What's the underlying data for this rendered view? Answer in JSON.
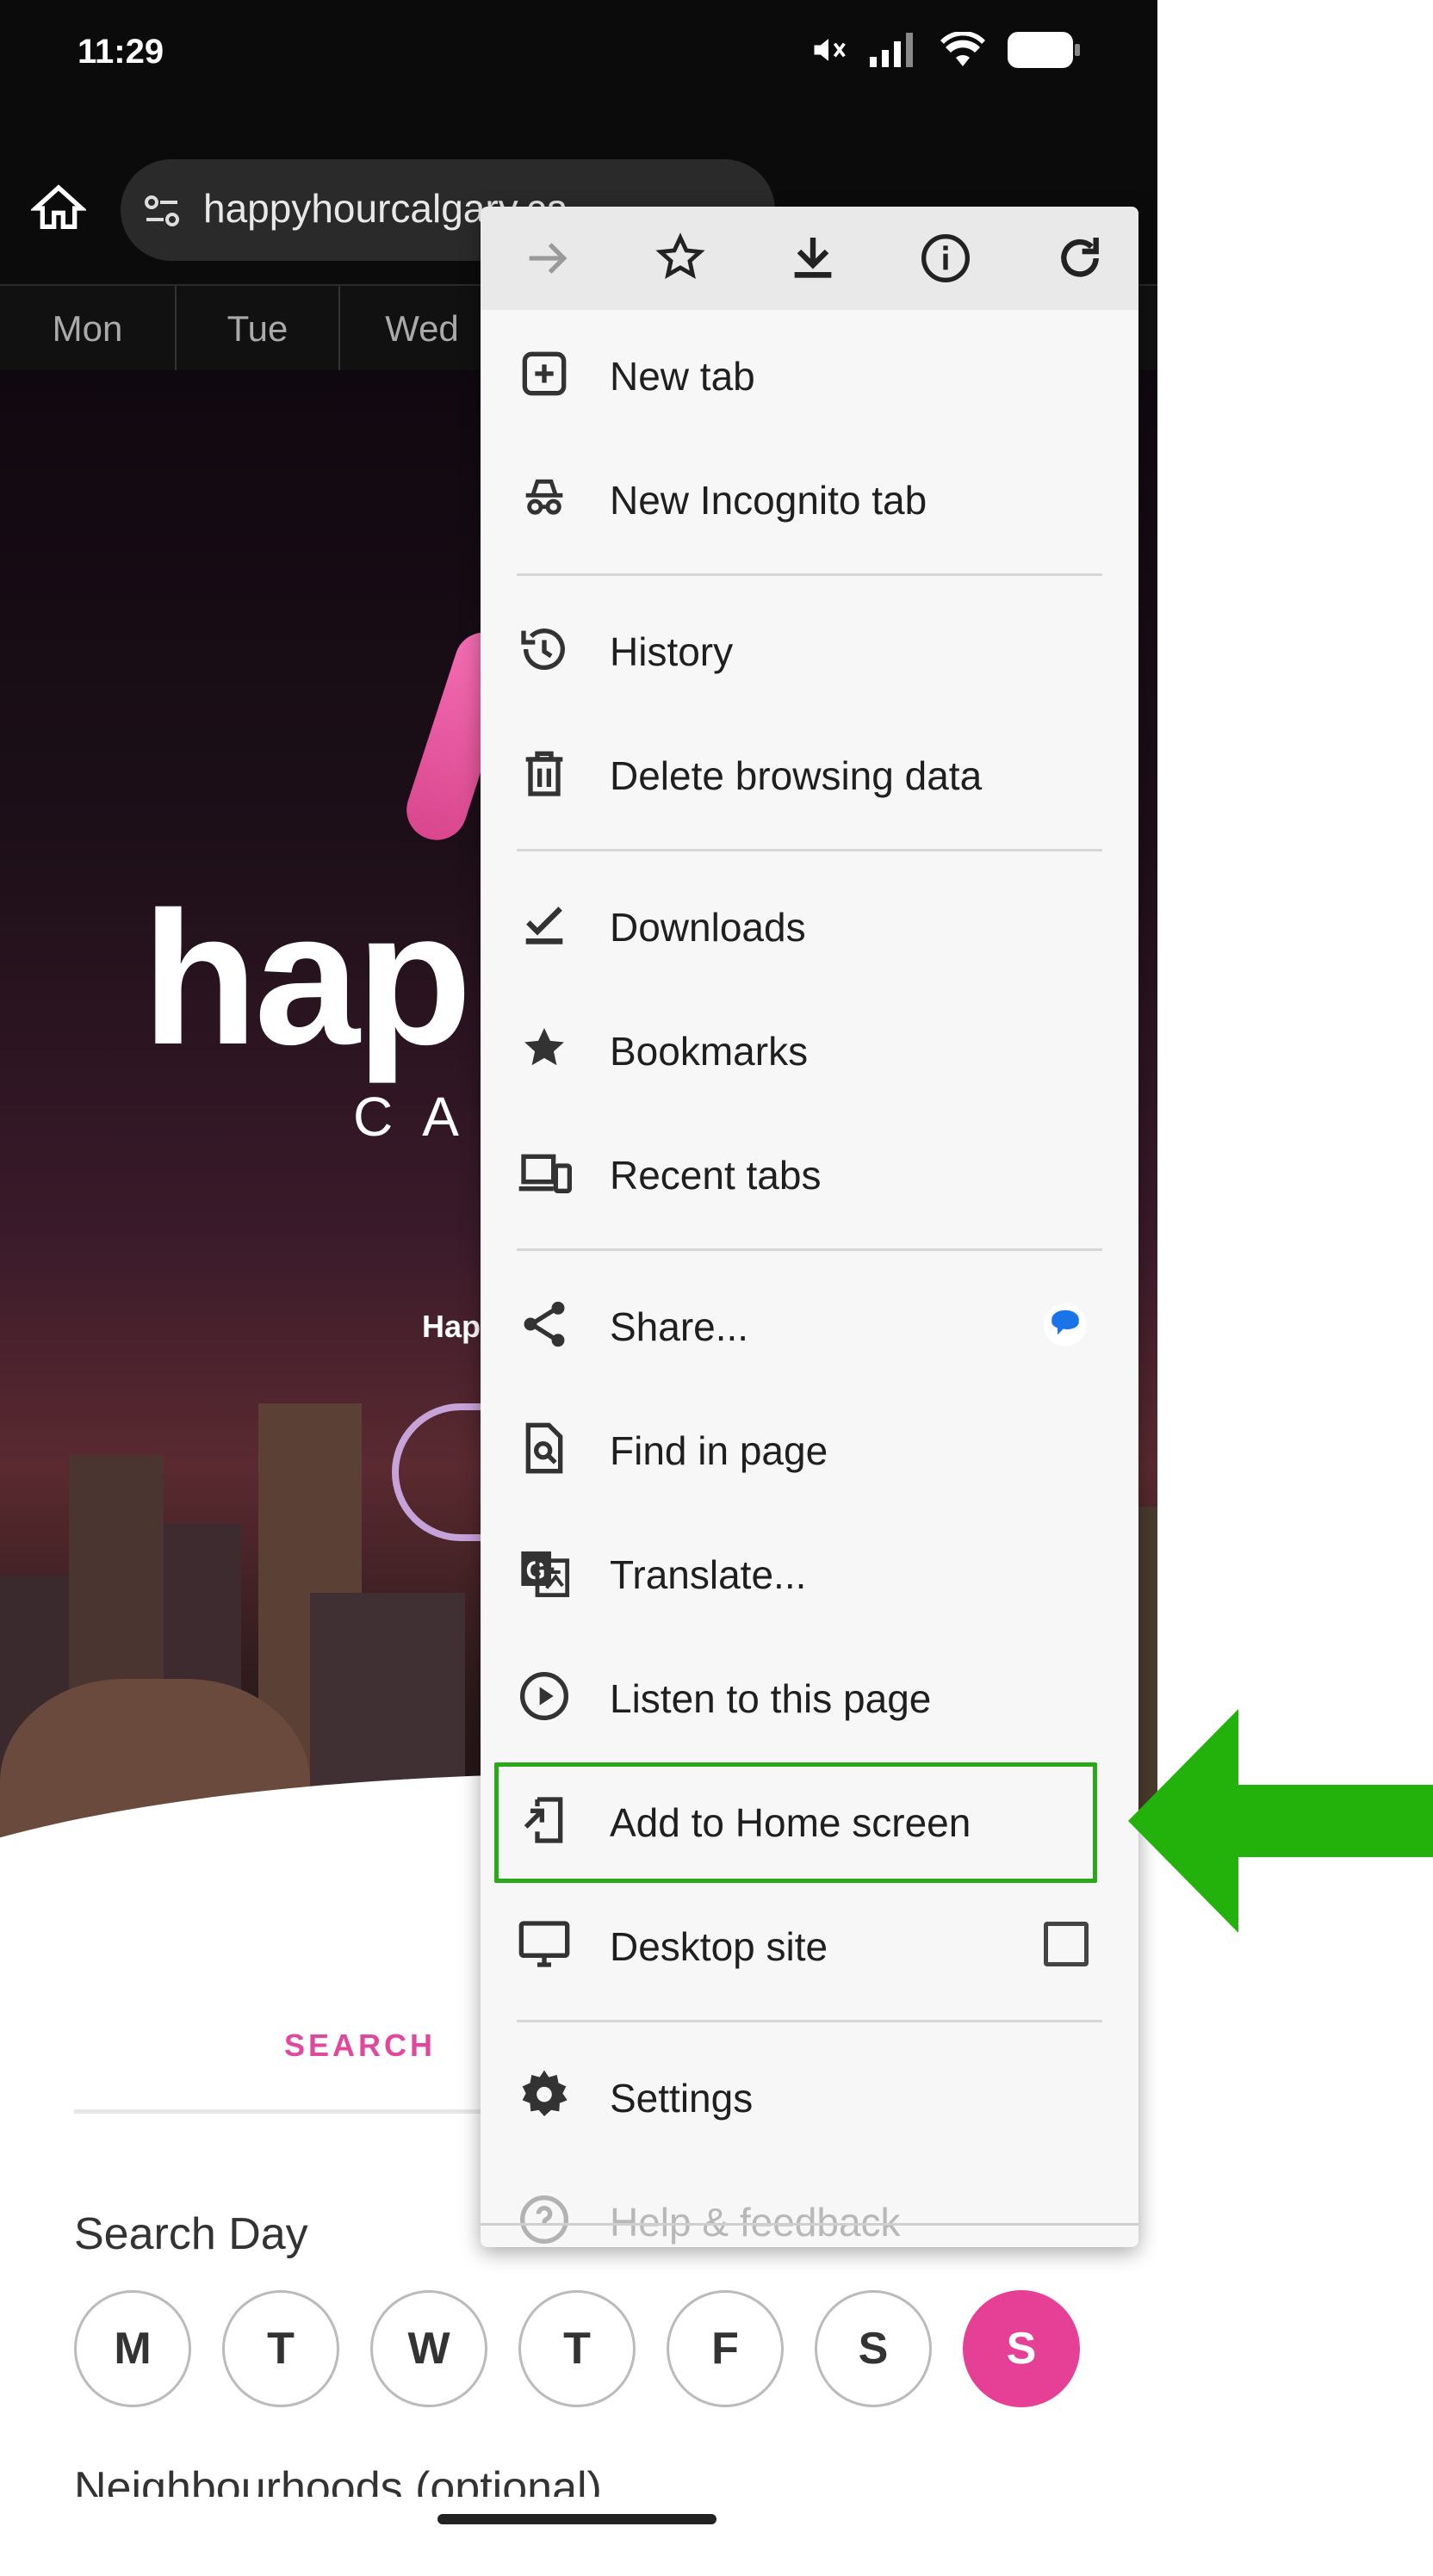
{
  "status_bar": {
    "time": "11:29"
  },
  "browser": {
    "url": "happyhourcalgary.ca"
  },
  "day_tabs": [
    "Mon",
    "Tue",
    "Wed"
  ],
  "hero": {
    "logo_text": "happ",
    "subtitle": "CA",
    "tagline": "Hap"
  },
  "page": {
    "search_tab": "SEARCH",
    "search_day_label": "Search Day",
    "days": [
      {
        "letter": "M",
        "active": false
      },
      {
        "letter": "T",
        "active": false
      },
      {
        "letter": "W",
        "active": false
      },
      {
        "letter": "T",
        "active": false
      },
      {
        "letter": "F",
        "active": false
      },
      {
        "letter": "S",
        "active": false
      },
      {
        "letter": "S",
        "active": true
      }
    ],
    "neighbourhoods_label": "Neighbourhoods (optional)"
  },
  "menu": {
    "toolbar": [
      "forward-icon",
      "bookmark-star-icon",
      "download-icon",
      "info-icon",
      "refresh-icon"
    ],
    "items": [
      {
        "label": "New tab",
        "icon": "new-tab-icon"
      },
      {
        "label": "New Incognito tab",
        "icon": "incognito-icon"
      },
      {
        "label": "History",
        "icon": "history-icon"
      },
      {
        "label": "Delete browsing data",
        "icon": "trash-icon"
      },
      {
        "label": "Downloads",
        "icon": "downloads-check-icon"
      },
      {
        "label": "Bookmarks",
        "icon": "star-icon"
      },
      {
        "label": "Recent tabs",
        "icon": "devices-icon"
      },
      {
        "label": "Share...",
        "icon": "share-icon"
      },
      {
        "label": "Find in page",
        "icon": "find-in-page-icon"
      },
      {
        "label": "Translate...",
        "icon": "translate-icon"
      },
      {
        "label": "Listen to this page",
        "icon": "play-circle-icon"
      },
      {
        "label": "Add to Home screen",
        "icon": "add-to-home-icon"
      },
      {
        "label": "Desktop site",
        "icon": "desktop-icon"
      },
      {
        "label": "Settings",
        "icon": "gear-icon"
      },
      {
        "label": "Help & feedback",
        "icon": "help-icon"
      }
    ],
    "desktop_site_checked": false
  },
  "colors": {
    "highlight_border": "#2aa81a",
    "arrow": "#23b20c",
    "accent_pink": "#e63f96"
  }
}
